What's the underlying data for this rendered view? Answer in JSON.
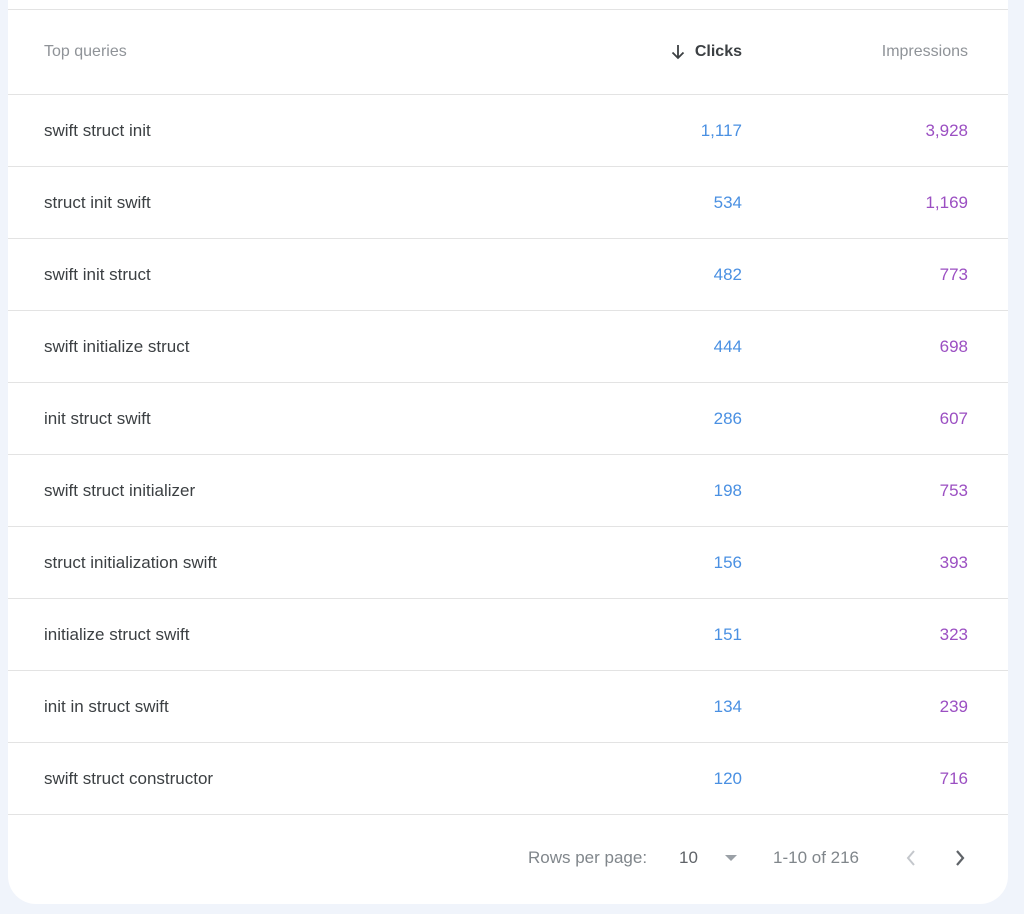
{
  "table": {
    "headers": {
      "query": "Top queries",
      "clicks": "Clicks",
      "impressions": "Impressions"
    },
    "sort": {
      "column": "clicks",
      "direction": "descending",
      "icon": "arrow-down-icon"
    },
    "rows": [
      {
        "query": "swift struct init",
        "clicks": "1,117",
        "impressions": "3,928"
      },
      {
        "query": "struct init swift",
        "clicks": "534",
        "impressions": "1,169"
      },
      {
        "query": "swift init struct",
        "clicks": "482",
        "impressions": "773"
      },
      {
        "query": "swift initialize struct",
        "clicks": "444",
        "impressions": "698"
      },
      {
        "query": "init struct swift",
        "clicks": "286",
        "impressions": "607"
      },
      {
        "query": "swift struct initializer",
        "clicks": "198",
        "impressions": "753"
      },
      {
        "query": "struct initialization swift",
        "clicks": "156",
        "impressions": "393"
      },
      {
        "query": "initialize struct swift",
        "clicks": "151",
        "impressions": "323"
      },
      {
        "query": "init in struct swift",
        "clicks": "134",
        "impressions": "239"
      },
      {
        "query": "swift struct constructor",
        "clicks": "120",
        "impressions": "716"
      }
    ]
  },
  "pagination": {
    "rows_per_page_label": "Rows per page:",
    "rows_per_page_value": "10",
    "range_text": "1-10 of 216",
    "prev_icon": "chevron-left-icon",
    "next_icon": "chevron-right-icon"
  },
  "colors": {
    "clicks": "#4a90e2",
    "impressions": "#9b4fc2",
    "background": "#f0f4fb"
  }
}
